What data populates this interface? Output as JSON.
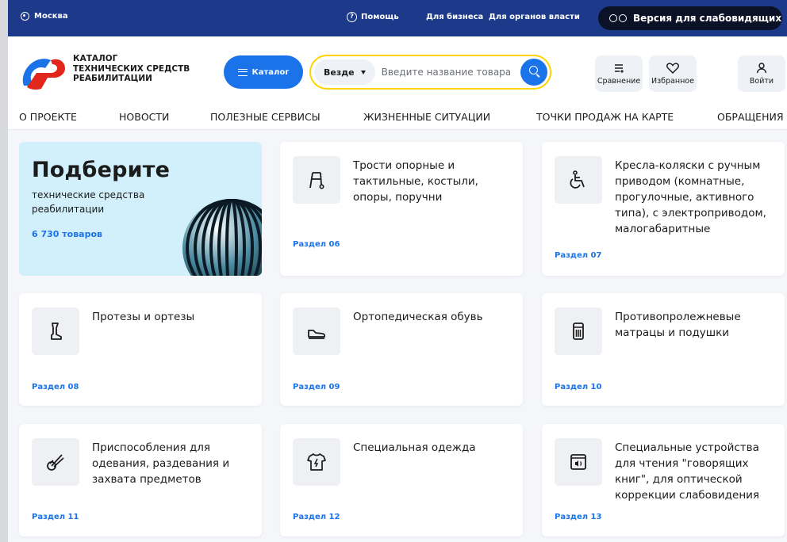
{
  "topbar": {
    "city": "Москва",
    "help": "Помощь",
    "business": "Для бизнеса",
    "government": "Для органов власти",
    "visually_impaired": "Версия для слабовидящих",
    "bg_color": "#1d3a8a"
  },
  "header": {
    "logo_line1": "КАТАЛОГ",
    "logo_line2": "ТЕХНИЧЕСКИХ СРЕДСТВ",
    "logo_line3": "РЕАБИЛИТАЦИИ",
    "catalog_label": "Каталог",
    "search_scope": "Везде",
    "search_placeholder": "Введите название товара",
    "compare_label": "Сравнение",
    "favorites_label": "Избранное",
    "login_label": "Войти",
    "accent_color": "#1a73e8",
    "search_border_color": "#ffd200"
  },
  "nav": {
    "items": [
      "О ПРОЕКТЕ",
      "НОВОСТИ",
      "ПОЛЕЗНЫЕ СЕРВИСЫ",
      "ЖИЗНЕННЫЕ СИТУАЦИИ",
      "ТОЧКИ ПРОДАЖ НА КАРТЕ",
      "ОБРАЩЕНИЯ"
    ]
  },
  "hero": {
    "title": "Подберите",
    "subtitle": "технические средства реабилитации",
    "count": "6 730 товаров"
  },
  "categories": [
    {
      "title": "Трости опорные и тактильные, костыли, опоры, поручни",
      "section": "Раздел 06",
      "icon": "walker-icon"
    },
    {
      "title": "Кресла-коляски с ручным приводом (комнатные, прогулочные, активного типа), с электроприводом, малогабаритные",
      "section": "Раздел 07",
      "icon": "wheelchair-icon"
    },
    {
      "title": "Протезы и ортезы",
      "section": "Раздел 08",
      "icon": "prosthesis-icon"
    },
    {
      "title": "Ортопедическая обувь",
      "section": "Раздел 09",
      "icon": "shoe-icon"
    },
    {
      "title": "Противопролежневые матрацы и подушки",
      "section": "Раздел 10",
      "icon": "mattress-icon"
    },
    {
      "title": "Приспособления для одевания, раздевания и захвата предметов",
      "section": "Раздел 11",
      "icon": "grabber-icon"
    },
    {
      "title": "Специальная одежда",
      "section": "Раздел 12",
      "icon": "tshirt-icon"
    },
    {
      "title": "Специальные устройства для чтения \"говорящих книг\", для оптической коррекции слабовидения",
      "section": "Раздел 13",
      "icon": "audiobook-icon"
    }
  ]
}
